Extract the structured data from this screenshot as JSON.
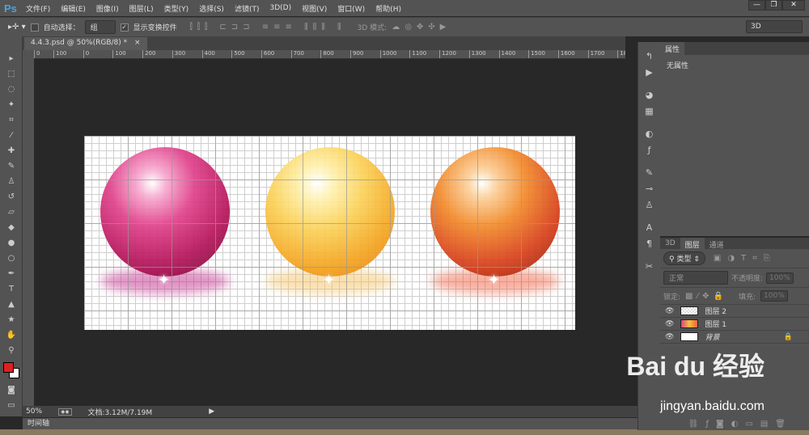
{
  "app": {
    "logo": "Ps"
  },
  "menu": [
    "文件(F)",
    "编辑(E)",
    "图像(I)",
    "图层(L)",
    "类型(Y)",
    "选择(S)",
    "滤镜(T)",
    "3D(D)",
    "视图(V)",
    "窗口(W)",
    "帮助(H)"
  ],
  "options": {
    "auto_select": "自动选择：",
    "auto_select_value": "组",
    "show_transform": "显示变换控件",
    "mode3d": "3D 模式:",
    "workspace": "3D"
  },
  "document": {
    "tab": "4.4.3.psd @ 50%(RGB/8) *",
    "close": "×"
  },
  "ruler": [
    "0",
    "100",
    "0",
    "100",
    "200",
    "300",
    "400",
    "500",
    "600",
    "700",
    "800",
    "900",
    "1000",
    "1100",
    "1200",
    "1300",
    "1400",
    "1500",
    "1600",
    "1700",
    "18"
  ],
  "status": {
    "zoom": "50%",
    "doc": "文档:3.12M/7.19M"
  },
  "timeline": "时间轴",
  "properties": {
    "tab": "属性",
    "empty": "无属性"
  },
  "layers": {
    "tabs": [
      "3D",
      "图层",
      "通道"
    ],
    "filter": "类型",
    "blend": "正常",
    "opacity_label": "不透明度:",
    "opacity": "100%",
    "lock_label": "锁定:",
    "fill_label": "填充:",
    "fill": "100%",
    "items": [
      {
        "name": "图层 2",
        "locked": false
      },
      {
        "name": "图层 1",
        "locked": false
      },
      {
        "name": "背景",
        "locked": true
      }
    ]
  },
  "colors": {
    "foreground": "#e02020",
    "background": "#ffffff"
  },
  "watermark": {
    "brand": "Bai du 经验",
    "url": "jingyan.baidu.com"
  }
}
